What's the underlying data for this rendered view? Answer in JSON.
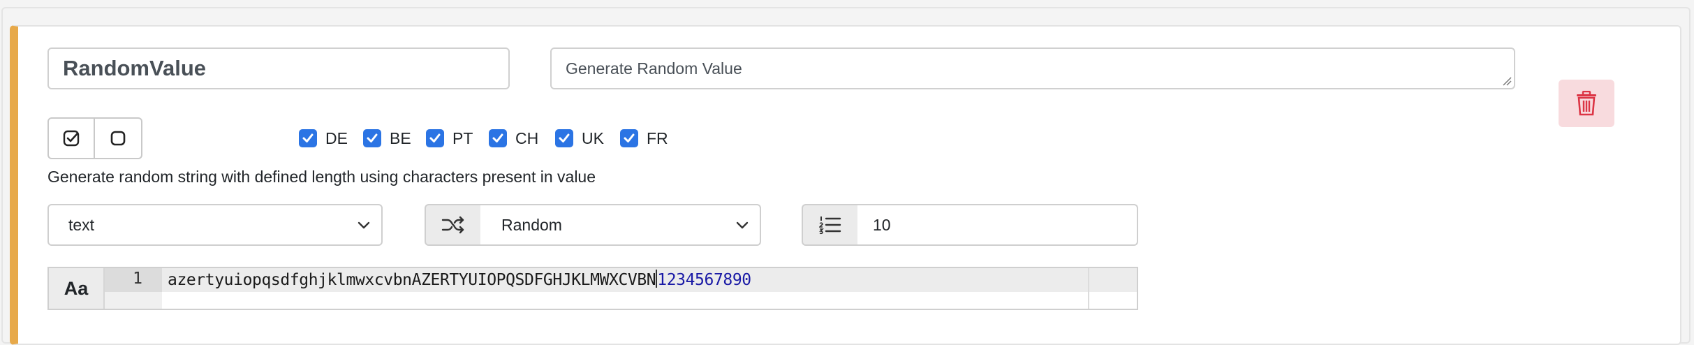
{
  "form": {
    "name_value": "RandomValue",
    "description_value": "Generate Random Value",
    "help_text": "Generate random string with defined length using characters present in value",
    "type_select": {
      "selected": "text"
    },
    "mode_select": {
      "selected": "Random"
    },
    "length_value": "10"
  },
  "countries": [
    {
      "code": "DE",
      "checked": true
    },
    {
      "code": "BE",
      "checked": true
    },
    {
      "code": "PT",
      "checked": true
    },
    {
      "code": "CH",
      "checked": true
    },
    {
      "code": "UK",
      "checked": true
    },
    {
      "code": "FR",
      "checked": true
    }
  ],
  "editor": {
    "font_toggle_label": "Aa",
    "line_number": "1",
    "code_text": "azertyuiopqsdfghjklmwxcvbnAZERTYUIOPQSDFGHJKLMWXCVBN",
    "code_number": "1234567890"
  },
  "icons": {
    "delete": "trash-icon",
    "select_all": "check-square-icon",
    "select_none": "square-icon",
    "shuffle": "shuffle-icon",
    "length": "list-ol-icon"
  },
  "colors": {
    "accent_border": "#e7a94a",
    "checkbox": "#2b74e4",
    "delete_bg": "#f8dbde",
    "delete_icon": "#dc3545",
    "code_number": "#1a1aa6"
  }
}
